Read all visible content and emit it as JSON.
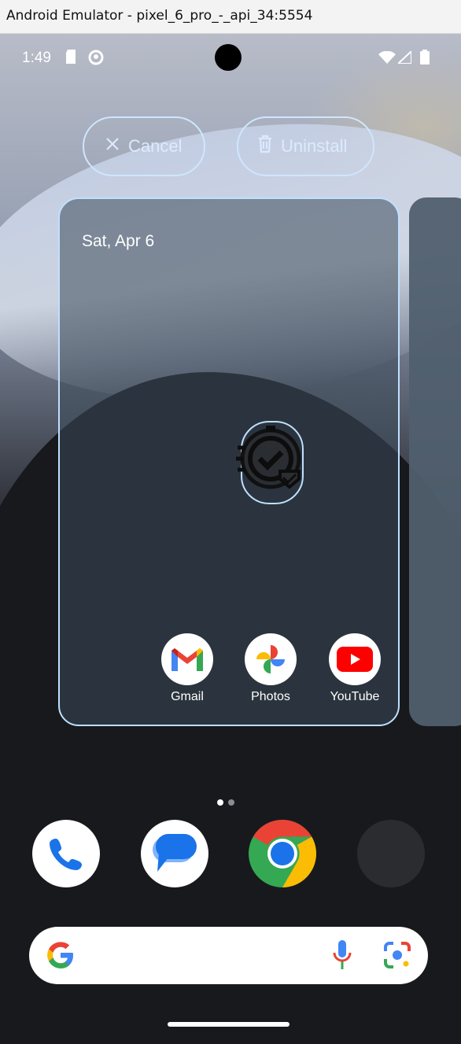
{
  "window": {
    "title": "Android Emulator - pixel_6_pro_-_api_34:5554"
  },
  "status_bar": {
    "time": "1:49"
  },
  "drop_targets": {
    "cancel_label": "Cancel",
    "uninstall_label": "Uninstall"
  },
  "home": {
    "date": "Sat, Apr 6",
    "apps": [
      {
        "label": "Gmail",
        "icon": "gmail-icon"
      },
      {
        "label": "Photos",
        "icon": "photos-icon"
      },
      {
        "label": "YouTube",
        "icon": "youtube-icon"
      }
    ],
    "page_indicator": {
      "pages": 2,
      "current": 1
    }
  },
  "dock": {
    "apps": [
      "phone-icon",
      "messages-icon",
      "chrome-icon",
      "empty-slot"
    ]
  },
  "search_bar": {
    "icons": [
      "google-g-icon",
      "microphone-icon",
      "lens-icon"
    ]
  },
  "colors": {
    "accent_outline": "#bfe0ff",
    "card_bg": "#4f5e6e"
  }
}
